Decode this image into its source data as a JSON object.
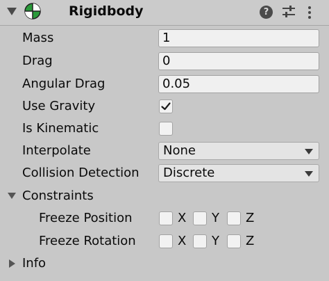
{
  "component": {
    "title": "Rigidbody",
    "icon": "rigidbody-sphere-icon",
    "help_glyph": "?",
    "accent_colors": {
      "green": "#2a9a3a",
      "dark": "#1f1f1f",
      "white": "#ffffff"
    }
  },
  "fields": {
    "mass": {
      "label": "Mass",
      "value": "1"
    },
    "drag": {
      "label": "Drag",
      "value": "0"
    },
    "angular_drag": {
      "label": "Angular Drag",
      "value": "0.05"
    },
    "use_gravity": {
      "label": "Use Gravity",
      "checked": true
    },
    "is_kinematic": {
      "label": "Is Kinematic",
      "checked": false
    },
    "interpolate": {
      "label": "Interpolate",
      "value": "None"
    },
    "collision_detection": {
      "label": "Collision Detection",
      "value": "Discrete"
    }
  },
  "constraints": {
    "label": "Constraints",
    "expanded": true,
    "freeze_position": {
      "label": "Freeze Position",
      "x": "X",
      "y": "Y",
      "z": "Z"
    },
    "freeze_rotation": {
      "label": "Freeze Rotation",
      "x": "X",
      "y": "Y",
      "z": "Z"
    }
  },
  "info": {
    "label": "Info",
    "expanded": false
  }
}
